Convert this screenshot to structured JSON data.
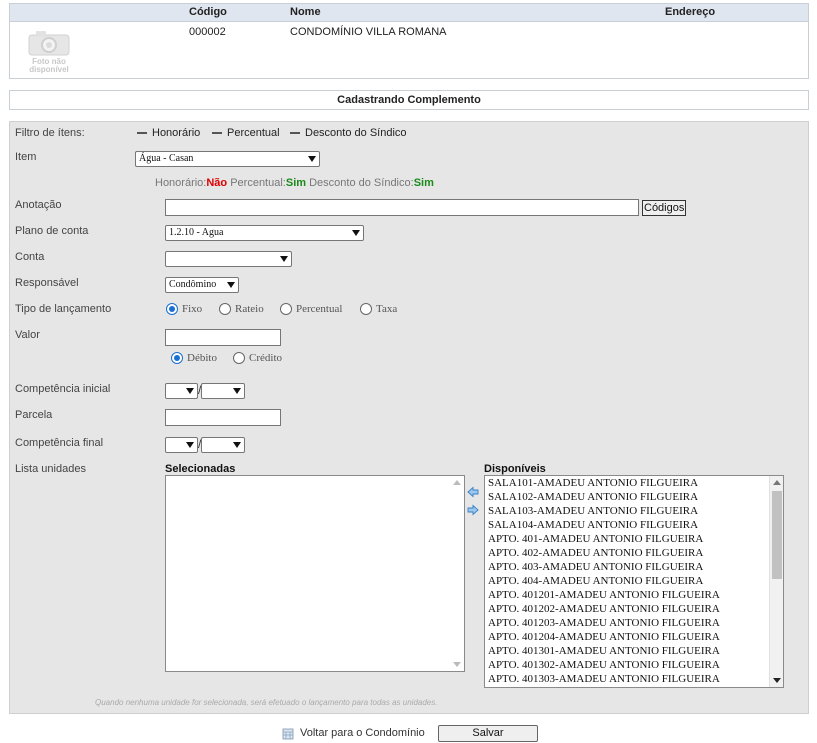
{
  "condo_table": {
    "headers": {
      "code": "Código",
      "name": "Nome",
      "address": "Endereço"
    },
    "row": {
      "code": "000002",
      "name": "CONDOMÍNIO VILLA ROMANA",
      "address": ""
    },
    "photo_text_1": "Foto não",
    "photo_text_2": "disponível"
  },
  "section_title": "Cadastrando Complemento",
  "form": {
    "filter_label": "Filtro de ítens:",
    "filter_options": [
      "Honorário",
      "Percentual",
      "Desconto do Síndico"
    ],
    "item_label": "Item",
    "item_value": "Água - Casan",
    "flags": {
      "honorario_label": "Honorário:",
      "honorario_value": "Não",
      "percentual_label": "Percentual:",
      "percentual_value": "Sim",
      "desconto_label": "Desconto do Síndico:",
      "desconto_value": "Sim"
    },
    "annotation_label": "Anotação",
    "annotation_value": "",
    "codes_button": "Códigos",
    "plan_label": "Plano de conta",
    "plan_value": "1.2.10 - Agua",
    "account_label": "Conta",
    "account_value": "",
    "responsible_label": "Responsável",
    "responsible_value": "Condômino",
    "type_label": "Tipo de lançamento",
    "type_options": [
      "Fixo",
      "Rateio",
      "Percentual",
      "Taxa"
    ],
    "type_selected": "Fixo",
    "value_label": "Valor",
    "value_value": "",
    "dc_options": [
      "Débito",
      "Crédito"
    ],
    "dc_selected": "Débito",
    "comp_initial_label": "Competência inicial",
    "parcel_label": "Parcela",
    "parcel_value": "",
    "comp_final_label": "Competência final",
    "units_label": "Lista unidades",
    "selected_title": "Selecionadas",
    "available_title": "Disponíveis",
    "selected_units": [],
    "available_units": [
      "SALA101-AMADEU ANTONIO FILGUEIRA",
      "SALA102-AMADEU ANTONIO FILGUEIRA",
      "SALA103-AMADEU ANTONIO FILGUEIRA",
      "SALA104-AMADEU ANTONIO FILGUEIRA",
      "APTO. 401-AMADEU ANTONIO FILGUEIRA",
      "APTO. 402-AMADEU ANTONIO FILGUEIRA",
      "APTO. 403-AMADEU ANTONIO FILGUEIRA",
      "APTO. 404-AMADEU ANTONIO FILGUEIRA",
      "APTO. 401201-AMADEU ANTONIO FILGUEIRA",
      "APTO. 401202-AMADEU ANTONIO FILGUEIRA",
      "APTO. 401203-AMADEU ANTONIO FILGUEIRA",
      "APTO. 401204-AMADEU ANTONIO FILGUEIRA",
      "APTO. 401301-AMADEU ANTONIO FILGUEIRA",
      "APTO. 401302-AMADEU ANTONIO FILGUEIRA",
      "APTO. 401303-AMADEU ANTONIO FILGUEIRA"
    ],
    "footnote": "Quando nenhuma unidade for selecionada, será efetuado o lançamento para todas as unidades."
  },
  "footer": {
    "back_link": "Voltar para o Condomínio",
    "save_button": "Salvar"
  },
  "icons": {
    "move_left": "arrow-left-icon",
    "move_right": "arrow-right-icon",
    "back": "building-icon"
  },
  "colors": {
    "header_bg": "#dfe6ef",
    "panel_bg": "#e6e6e6",
    "no_color": "#dd0000",
    "yes_color": "#1a8a1a",
    "radio_accent": "#1a6fd1"
  }
}
